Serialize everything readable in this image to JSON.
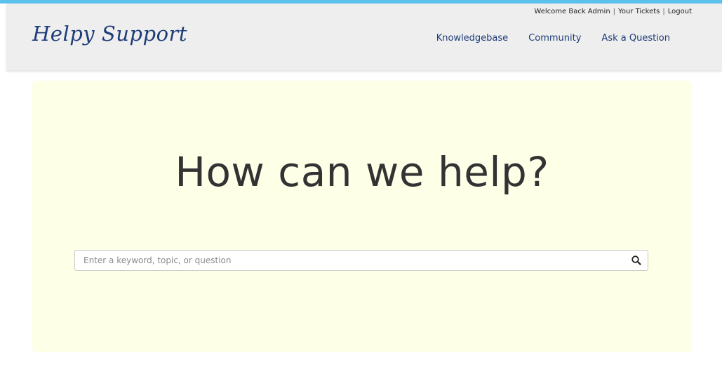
{
  "colors": {
    "accent_bar": "#5bc0eb",
    "header_bg": "#eeeeee",
    "brand": "#1d3c78",
    "hero_bg": "#fdffe7"
  },
  "header": {
    "logo": "Helpy Support",
    "user_bar": {
      "welcome": "Welcome Back Admin",
      "separator": "|",
      "your_tickets": "Your Tickets",
      "logout": "Logout"
    },
    "nav": [
      {
        "label": "Knowledgebase"
      },
      {
        "label": "Community"
      },
      {
        "label": "Ask a Question"
      }
    ]
  },
  "hero": {
    "title": "How can we help?",
    "search": {
      "placeholder": "Enter a keyword, topic, or question",
      "value": "",
      "icon": "search-icon"
    }
  }
}
